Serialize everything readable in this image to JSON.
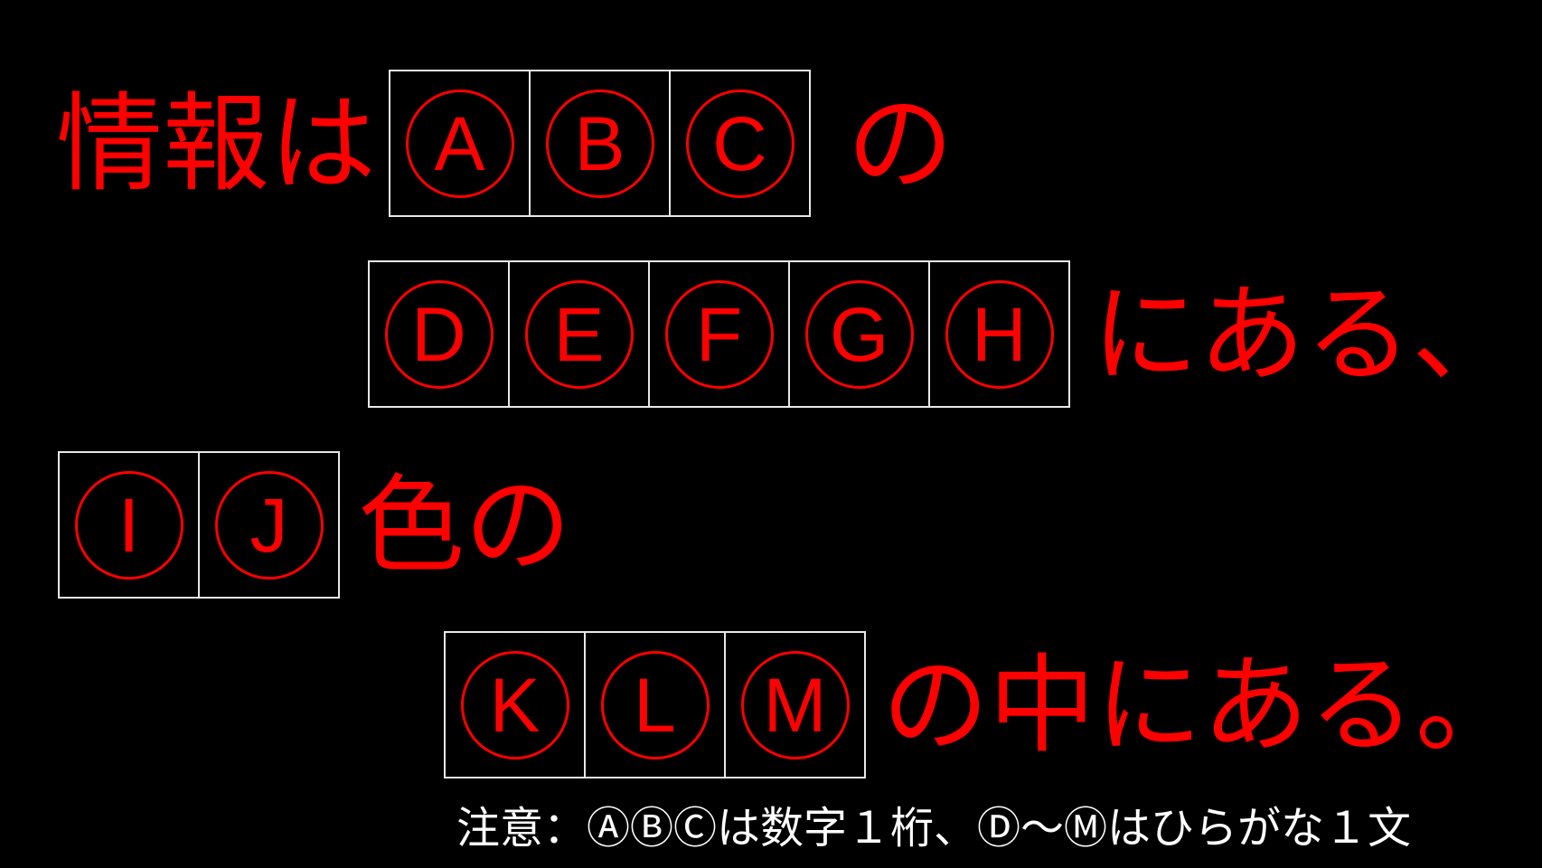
{
  "colors": {
    "background": "#000000",
    "text": "#ff0000",
    "box_border": "#e8e8e8",
    "note": "#ffffff"
  },
  "line1": {
    "prefix": "情報は",
    "boxes": [
      "A",
      "B",
      "C"
    ],
    "suffix": "の"
  },
  "line2": {
    "boxes": [
      "D",
      "E",
      "F",
      "G",
      "H"
    ],
    "suffix": "にある、"
  },
  "line3": {
    "boxes": [
      "I",
      "J"
    ],
    "suffix": "色の"
  },
  "line4": {
    "boxes": [
      "K",
      "L",
      "M"
    ],
    "suffix": "の中にある。"
  },
  "note": "注意：ⒶⒷⒸは数字１桁、Ⓓ〜Ⓜはひらがな１文"
}
